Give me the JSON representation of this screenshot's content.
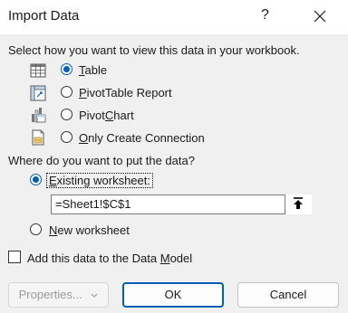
{
  "window": {
    "title": "Import Data",
    "help_label": "?"
  },
  "view": {
    "prompt": "Select how you want to view this data in your workbook.",
    "options": [
      {
        "pre": "",
        "key": "T",
        "post": "able",
        "icon": "table-icon",
        "checked": true
      },
      {
        "pre": "",
        "key": "P",
        "post": "ivotTable Report",
        "icon": "pivottable-icon",
        "checked": false
      },
      {
        "pre": "Pivot",
        "key": "C",
        "post": "hart",
        "icon": "pivotchart-icon",
        "checked": false
      },
      {
        "pre": "",
        "key": "O",
        "post": "nly Create Connection",
        "icon": "connection-icon",
        "checked": false
      }
    ]
  },
  "location": {
    "prompt": "Where do you want to put the data?",
    "existing": {
      "pre": "",
      "key": "E",
      "post": "xisting worksheet:"
    },
    "existing_checked": true,
    "range_value": "=Sheet1!$C$1",
    "new": {
      "pre": "",
      "key": "N",
      "post": "ew worksheet"
    },
    "new_checked": false
  },
  "data_model": {
    "pre": "Add this data to the Data ",
    "key": "M",
    "post": "odel",
    "checked": false
  },
  "buttons": {
    "properties": "Properties...",
    "ok": "OK",
    "cancel": "Cancel"
  },
  "colors": {
    "accent": "#005fb8",
    "background": "#f0f0f0"
  }
}
